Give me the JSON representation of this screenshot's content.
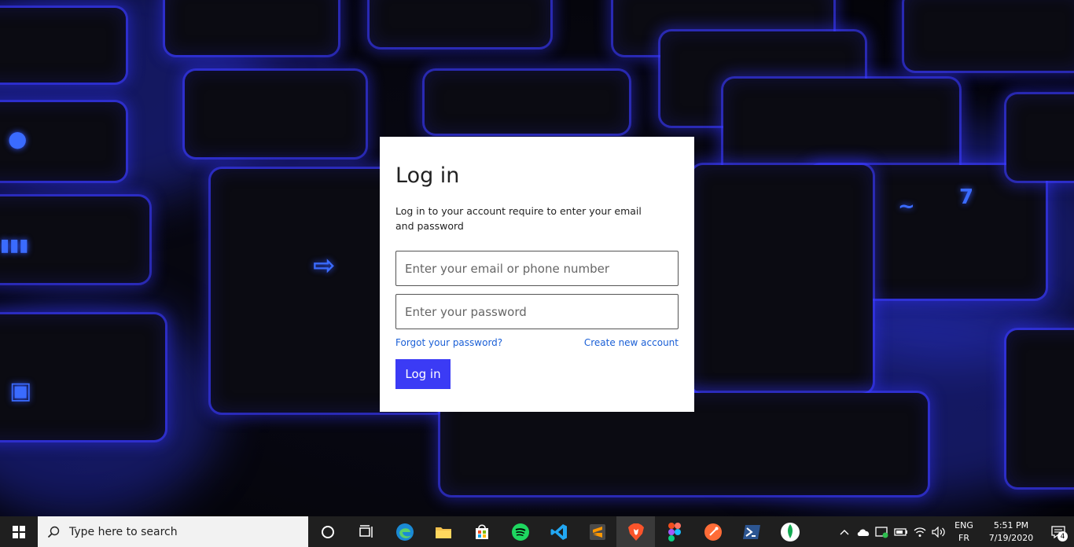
{
  "login": {
    "title": "Log in",
    "description": "Log in to your account require to enter your email and password",
    "email_placeholder": "Enter your email or phone number",
    "password_placeholder": "Enter your password",
    "forgot_link": "Forgot your password?",
    "create_link": "Create new account",
    "submit_label": "Log in"
  },
  "colors": {
    "button": "#3b3bf5",
    "link": "#1a5fd6",
    "card": "#ffffff"
  },
  "taskbar": {
    "search_placeholder": "Type here to search",
    "apps": [
      "cortana-icon",
      "task-view-icon",
      "edge-icon",
      "file-explorer-icon",
      "store-icon",
      "spotify-icon",
      "vscode-icon",
      "sublime-icon",
      "brave-icon",
      "figma-icon",
      "postman-icon",
      "powershell-icon",
      "mongodb-icon"
    ],
    "lang_top": "ENG",
    "lang_bottom": "FR",
    "time": "5:51 PM",
    "date": "7/19/2020",
    "notification_count": "4"
  }
}
